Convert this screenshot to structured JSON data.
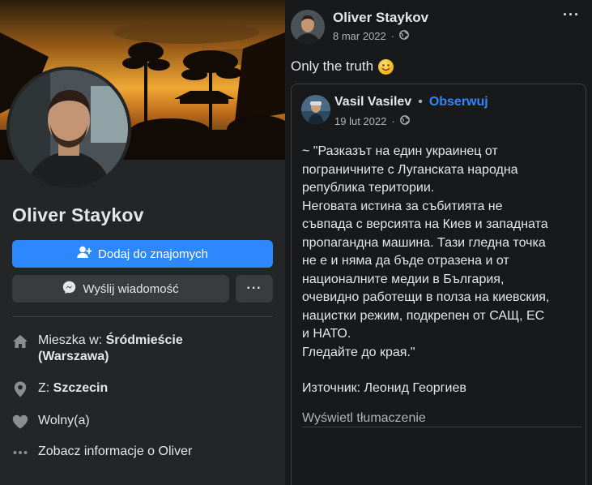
{
  "profile": {
    "name": "Oliver Staykov",
    "add_friend_label": "Dodaj do znajomych",
    "message_label": "Wyślij wiadomość",
    "more_label": "···",
    "info": {
      "lives_prefix": "Mieszka w: ",
      "lives_place": "Śródmieście",
      "lives_region": "(Warszawa)",
      "from_prefix": "Z: ",
      "from_place": "Szczecin",
      "relationship": "Wolny(a)",
      "see_about": "Zobacz informacje o Oliver"
    }
  },
  "post": {
    "author": "Oliver Staykov",
    "date": "8 mar 2022",
    "privacy_icon": "globe-icon",
    "more_label": "···",
    "text": "Only the truth",
    "emoji": "smiling-face",
    "shared": {
      "author": "Vasil Vasilev",
      "separator": "•",
      "follow_label": "Obserwuj",
      "date": "19 lut 2022",
      "body_lines": [
        "~ \"Разказът на един украинец от",
        "пограничните с Луганската народна",
        "република територии.",
        "Неговата истина за събитията не",
        "съвпада с версията на Киев и западната",
        "пропагандна машина. Тази гледна точка",
        "не е и няма да бъде отразена и от",
        "националните медии в България,",
        "очевидно работещи в полза на киевския,",
        "нацистки режим, подкрепен от САЩ, ЕС",
        "и НАТО.",
        "Гледайте до края.\""
      ],
      "source": "Източник: Леонид Георгиев",
      "translate_label": "Wyświetl tłumaczenie"
    }
  },
  "colors": {
    "background": "#18191a",
    "panel": "#242526",
    "accent": "#2d88ff",
    "secondary_text": "#b0b3b8"
  }
}
